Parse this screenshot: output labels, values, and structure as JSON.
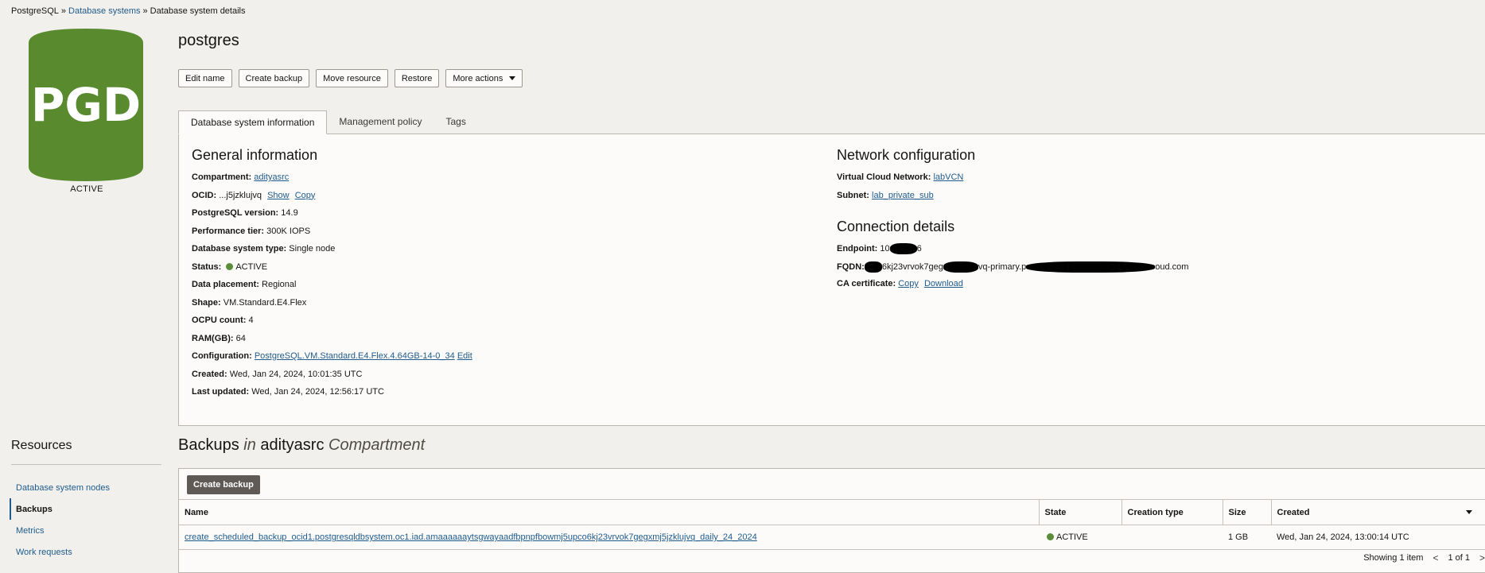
{
  "breadcrumb": {
    "root": "PostgreSQL",
    "sep": "»",
    "systems": "Database systems",
    "current": "Database system details"
  },
  "logo": {
    "text": "PGD",
    "status": "ACTIVE",
    "color": "#5a8a2e"
  },
  "title": "postgres",
  "actions": {
    "edit_name": "Edit name",
    "create_backup": "Create backup",
    "move_resource": "Move resource",
    "restore": "Restore",
    "more_actions": "More actions"
  },
  "tabs": {
    "info": "Database system information",
    "policy": "Management policy",
    "tags": "Tags"
  },
  "general": {
    "title": "General information",
    "compartment_label": "Compartment:",
    "compartment": "adityasrc",
    "ocid_label": "OCID:",
    "ocid": "...j5jzklujvq",
    "show": "Show",
    "copy": "Copy",
    "version_label": "PostgreSQL version:",
    "version": "14.9",
    "perf_label": "Performance tier:",
    "perf": "300K IOPS",
    "type_label": "Database system type:",
    "type": "Single node",
    "status_label": "Status:",
    "status": "ACTIVE",
    "placement_label": "Data placement:",
    "placement": "Regional",
    "shape_label": "Shape:",
    "shape": "VM.Standard.E4.Flex",
    "ocpu_label": "OCPU count:",
    "ocpu": "4",
    "ram_label": "RAM(GB):",
    "ram": "64",
    "config_label": "Configuration:",
    "config": "PostgreSQL.VM.Standard.E4.Flex.4.64GB-14-0_34",
    "edit": "Edit",
    "created_label": "Created:",
    "created": "Wed, Jan 24, 2024, 10:01:35 UTC",
    "updated_label": "Last updated:",
    "updated": "Wed, Jan 24, 2024, 12:56:17 UTC"
  },
  "network": {
    "title": "Network configuration",
    "vcn_label": "Virtual Cloud Network:",
    "vcn": "labVCN",
    "subnet_label": "Subnet:",
    "subnet": "lab_private_sub"
  },
  "connection": {
    "title": "Connection details",
    "endpoint_label": "Endpoint:",
    "endpoint_a": "10",
    "endpoint_b": "6",
    "fqdn_label": "FQDN:",
    "fqdn_a": "6kj23vrvok7geg",
    "fqdn_b": "vq-primary.p",
    "fqdn_c": "oud.com",
    "ca_label": "CA certificate:",
    "copy": "Copy",
    "download": "Download"
  },
  "resources": {
    "title": "Resources",
    "items": [
      "Database system nodes",
      "Backups",
      "Metrics",
      "Work requests"
    ]
  },
  "backups": {
    "title_pre": "Backups",
    "title_in": "in",
    "title_comp": "adityasrc",
    "title_post": "Compartment",
    "create": "Create backup",
    "columns": [
      "Name",
      "State",
      "Creation type",
      "Size",
      "Created"
    ],
    "row": {
      "name": "create_scheduled_backup_ocid1.postgresqldbsystem.oc1.iad.amaaaaaaytsgwayaadfbpnpfbowmj5upco6kj23vrvok7gegxmj5jzklujvq_daily_24_2024",
      "state": "ACTIVE",
      "creation_type": "",
      "size": "1 GB",
      "created": "Wed, Jan 24, 2024, 13:00:14 UTC"
    },
    "showing": "Showing 1 item",
    "page": "1 of 1"
  }
}
